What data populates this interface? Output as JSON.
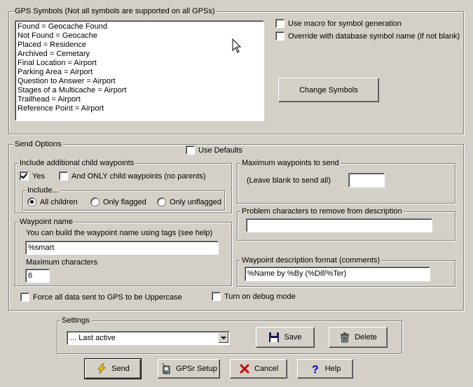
{
  "gps_symbols": {
    "legend": "GPS Symbols (Not all symbols are supported on all GPSs)",
    "items": [
      "Found = Geocache Found",
      "Not Found = Geocache",
      "Placed = Residence",
      "Archived = Cemetary",
      "Final Location = Airport",
      "Parking Area = Airport",
      "Question to Answer = Airport",
      "Stages of a Multicache = Airport",
      "Trailhead = Airport",
      "Reference Point = Airport"
    ],
    "use_macro_label": "Use macro for symbol generation",
    "use_macro_checked": false,
    "override_label": "Override with database symbol name (if not blank)",
    "override_checked": false,
    "change_symbols_label": "Change Symbols"
  },
  "send_options": {
    "legend": "Send Options",
    "use_defaults_label": "Use Defaults",
    "use_defaults_checked": false,
    "child": {
      "legend": "Include additional child waypoints",
      "yes_label": "Yes",
      "yes_checked": true,
      "only_child_label": "And ONLY child waypoints (no parents)",
      "only_child_checked": false,
      "include_legend": "Include...",
      "radio_all": "All children",
      "radio_flagged": "Only flagged",
      "radio_unflagged": "Only unflagged",
      "selected": "all"
    },
    "waypoint_name": {
      "legend": "Waypoint name",
      "hint": "You can build the waypoint name using tags (see help)",
      "value": "%smart",
      "max_chars_label": "Maximum characters",
      "max_chars_value": "6"
    },
    "max_waypoints": {
      "legend": "Maximum waypoints to send",
      "hint": "(Leave blank to send all)",
      "value": ""
    },
    "problem_chars": {
      "legend": "Problem characters to remove from description",
      "value": ""
    },
    "desc_format": {
      "legend": "Waypoint description format (comments)",
      "value": "%Name by %By (%Dif/%Ter)"
    },
    "uppercase_label": "Force all data sent to GPS to be Uppercase",
    "uppercase_checked": false,
    "debug_label": "Turn on debug mode",
    "debug_checked": false
  },
  "settings": {
    "legend": "Settings",
    "selected": "... Last active",
    "save_label": "Save",
    "delete_label": "Delete"
  },
  "buttons": {
    "send": "Send",
    "gpsr_setup": "GPSr Setup",
    "cancel": "Cancel",
    "help": "Help"
  },
  "icons": {
    "send": "lightning-icon",
    "gpsr_setup": "gps-device-icon",
    "cancel": "x-icon",
    "help": "question-mark-icon",
    "save": "floppy-disk-icon",
    "delete": "trash-can-icon",
    "cursor": "mouse-pointer-icon"
  },
  "colors": {
    "background": "#d4d0c8",
    "cancel_x": "#cc0000",
    "help_q": "#0000cc",
    "lightning": "#e8c800"
  }
}
